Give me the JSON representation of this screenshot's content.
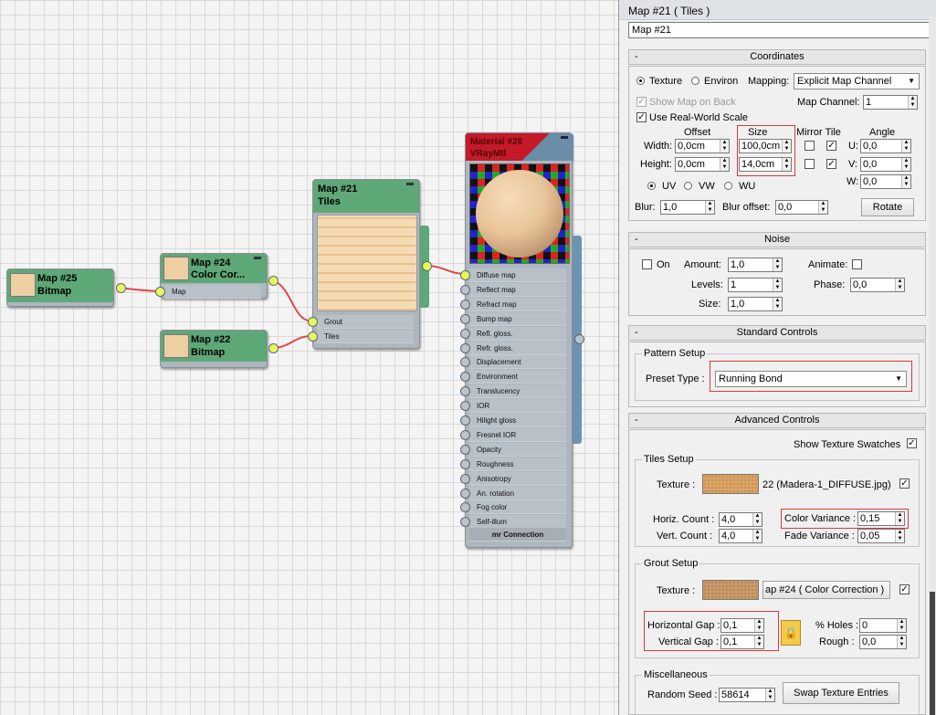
{
  "nodes": {
    "map25": {
      "name": "Map #25",
      "type": "Bitmap"
    },
    "map24": {
      "name": "Map #24",
      "type": "Color Cor...",
      "slots": [
        "Map"
      ]
    },
    "map22": {
      "name": "Map #22",
      "type": "Bitmap"
    },
    "map21": {
      "name": "Map #21",
      "type": "Tiles",
      "slots": [
        "Grout",
        "Tiles"
      ]
    },
    "material": {
      "name": "Material #26",
      "type": "VRayMtl",
      "slots": [
        "Diffuse map",
        "Reflect map",
        "Refract map",
        "Bump map",
        "Refl. gloss.",
        "Refr. gloss.",
        "Displacement",
        "Environment",
        "Translucency",
        "IOR",
        "Hilight gloss",
        "Fresnel IOR",
        "Opacity",
        "Roughness",
        "Anisotropy",
        "An. rotation",
        "Fog color",
        "Self-illum"
      ],
      "footer": "mr Connection"
    }
  },
  "panel": {
    "title": "Map #21  ( Tiles )",
    "name_value": "Map #21",
    "coordinates": {
      "title": "Coordinates",
      "texture": "Texture",
      "environ": "Environ",
      "mapping_label": "Mapping:",
      "mapping_value": "Explicit Map Channel",
      "show_map_on_back": "Show Map on Back",
      "use_real_world": "Use Real-World Scale",
      "map_channel_label": "Map Channel:",
      "map_channel": "1",
      "offset": "Offset",
      "size": "Size",
      "mirror_tile": "Mirror Tile",
      "angle": "Angle",
      "width_label": "Width:",
      "height_label": "Height:",
      "width_offset": "0,0cm",
      "height_offset": "0,0cm",
      "width_size": "100,0cm",
      "height_size": "14,0cm",
      "u_label": "U:",
      "v_label": "V:",
      "w_label": "W:",
      "u": "0,0",
      "v": "0,0",
      "w": "0,0",
      "uv": "UV",
      "vw": "VW",
      "wu": "WU",
      "blur_label": "Blur:",
      "blur": "1,0",
      "blur_offset_label": "Blur offset:",
      "blur_offset": "0,0",
      "rotate": "Rotate"
    },
    "noise": {
      "title": "Noise",
      "on": "On",
      "amount_label": "Amount:",
      "amount": "1,0",
      "levels_label": "Levels:",
      "levels": "1",
      "size_label": "Size:",
      "size": "1,0",
      "animate": "Animate:",
      "phase_label": "Phase:",
      "phase": "0,0"
    },
    "standard": {
      "title": "Standard Controls",
      "pattern_setup": "Pattern Setup",
      "preset_label": "Preset Type :",
      "preset_value": "Running Bond"
    },
    "advanced": {
      "title": "Advanced Controls",
      "show_swatches": "Show Texture Swatches",
      "tiles_setup": "Tiles Setup",
      "texture_label": "Texture :",
      "tiles_texture_name": "22 (Madera-1_DIFFUSE.jpg)",
      "horiz_label": "Horiz. Count :",
      "horiz": "4,0",
      "vert_label": "Vert. Count :",
      "vert": "4,0",
      "color_var_label": "Color Variance :",
      "color_var": "0,15",
      "fade_var_label": "Fade Variance :",
      "fade_var": "0,05",
      "grout_setup": "Grout Setup",
      "grout_texture_name": "ap #24  ( Color Correction )",
      "hgap_label": "Horizontal Gap :",
      "hgap": "0,1",
      "vgap_label": "Vertical Gap :",
      "vgap": "0,1",
      "holes_label": "% Holes :",
      "holes": "0",
      "rough_label": "Rough :",
      "rough": "0,0",
      "misc": "Miscellaneous",
      "seed_label": "Random Seed :",
      "seed": "58614",
      "swap": "Swap Texture Entries"
    }
  },
  "colors": {
    "node_header": "#5ea878",
    "highlight": "#d23c3c",
    "port": "#e4f95a"
  }
}
